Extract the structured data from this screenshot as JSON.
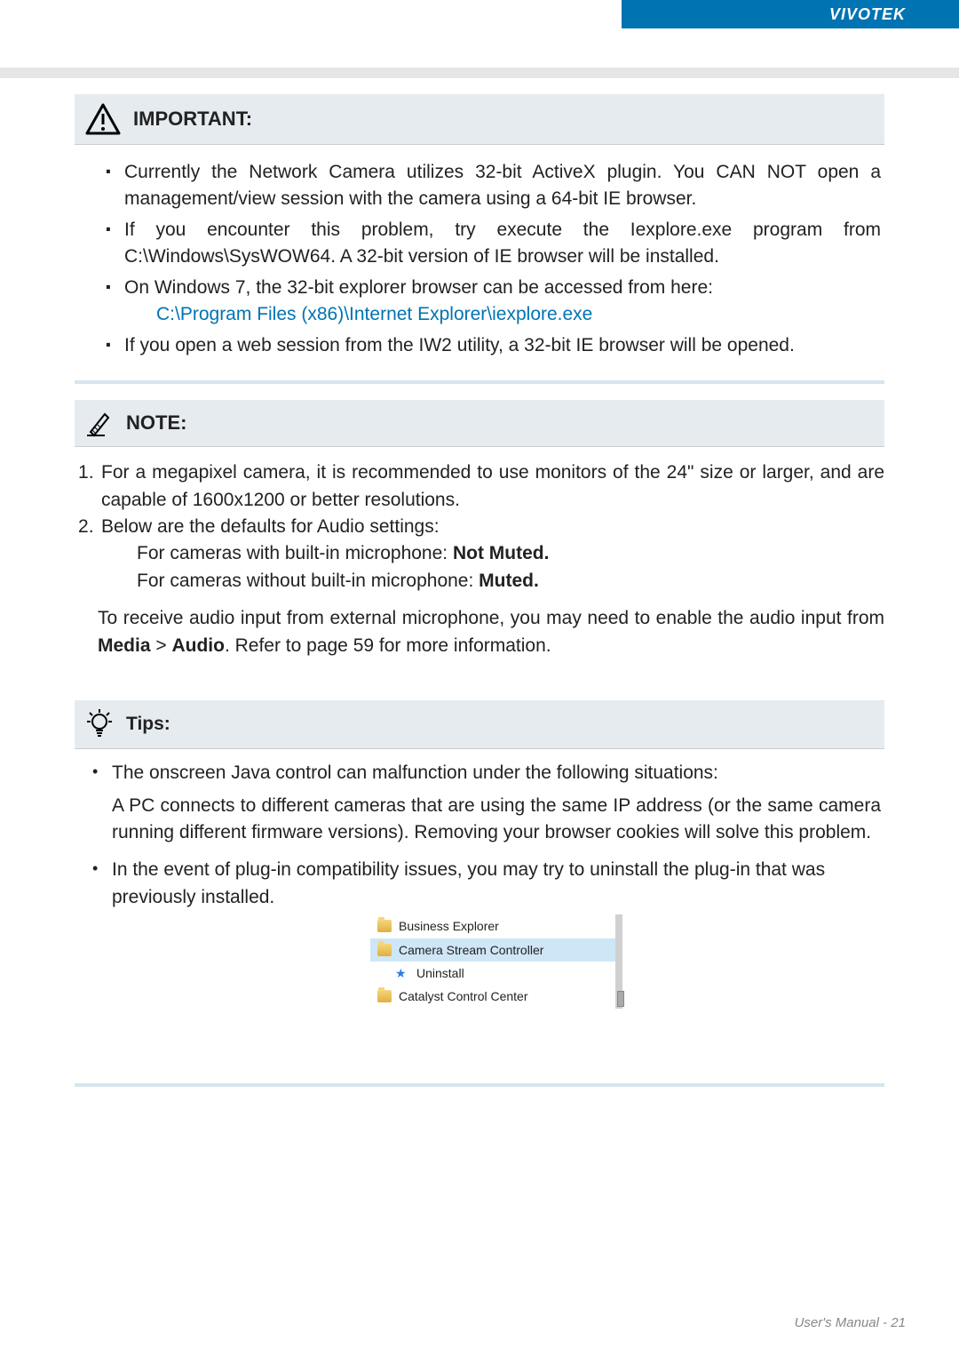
{
  "brand": "VIVOTEK",
  "important": {
    "title": "IMPORTANT:",
    "items": [
      "Currently the Network Camera utilizes 32-bit ActiveX plugin. You CAN NOT open a management/view session with the camera using a 64-bit IE browser.",
      "If you encounter this problem, try execute the Iexplore.exe program from C:\\Windows\\SysWOW64. A 32-bit version of IE browser will be installed.",
      "On Windows 7, the 32-bit explorer browser can be accessed from here:",
      "If you open a web session from the IW2 utility, a 32-bit IE browser will be opened."
    ],
    "path": "C:\\Program Files (x86)\\Internet Explorer\\iexplore.exe"
  },
  "note": {
    "title": "NOTE:",
    "items": [
      "For a megapixel camera, it is recommended to use monitors of the 24\" size or larger, and are capable of 1600x1200 or better resolutions.",
      "Below are the defaults for Audio settings:"
    ],
    "sub1_prefix": "For cameras with built-in microphone: ",
    "sub1_bold": "Not Muted.",
    "sub2_prefix": "For cameras without built-in microphone: ",
    "sub2_bold": "Muted.",
    "para_prefix": "To receive audio input from external microphone, you may need to enable the audio input from ",
    "media": "Media",
    "gt": " > ",
    "audio": "Audio",
    "para_suffix": ". Refer to page 59 for more information."
  },
  "tips": {
    "title": "Tips:",
    "item1": "The onscreen Java control can malfunction under the following situations:",
    "item1_sub": "A PC connects to different cameras that are using the same IP address (or the same camera running different firmware versions). Removing your browser cookies will solve this problem.",
    "item2": "In the event of plug-in compatibility issues, you may try to uninstall the plug-in that was previously installed."
  },
  "menu": {
    "r1": "Business Explorer",
    "r2": "Camera Stream Controller",
    "r3": "Uninstall",
    "r4": "Catalyst Control Center"
  },
  "footer": "User's Manual - 21"
}
